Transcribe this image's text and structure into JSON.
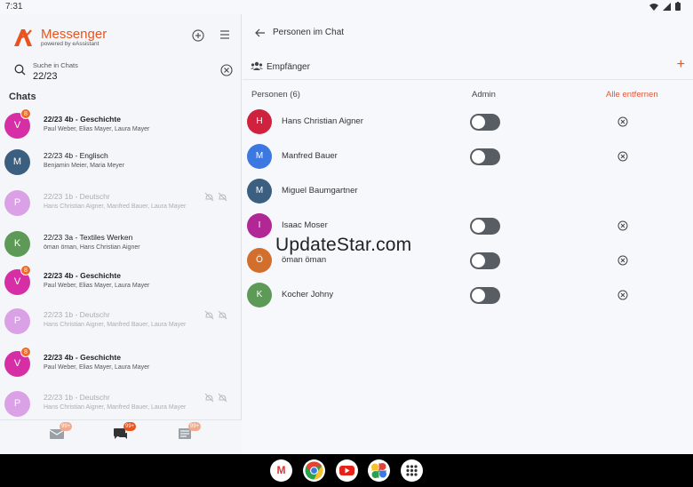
{
  "status_bar": {
    "time": "7:31",
    "icons": [
      "wifi-icon",
      "signal-icon",
      "battery-icon"
    ]
  },
  "brand": {
    "name": "Messenger",
    "tagline": "powered by eAssistant",
    "color": "#e8541f"
  },
  "search": {
    "label": "Suche in Chats",
    "value": "22/23"
  },
  "chats_heading": "Chats",
  "chats": [
    {
      "initial": "V",
      "color": "#d62fa5",
      "badge": "8",
      "title": "22/23  4b - Geschichte",
      "members": "Paul Weber, Elias Mayer, Laura Mayer",
      "bold": true,
      "muted": false
    },
    {
      "initial": "M",
      "color": "#3b5f80",
      "badge": "",
      "title": "22/23  4b - Englisch",
      "members": "Benjamin Meier, Maria Meyer",
      "bold": false,
      "muted": false
    },
    {
      "initial": "P",
      "color": "#d07ee0",
      "badge": "",
      "title": "22/23  1b - Deutschr",
      "members": "Hans Christian Aigner, Manfred Bauer, Laura Mayer",
      "bold": false,
      "muted": true
    },
    {
      "initial": "K",
      "color": "#5e9a57",
      "badge": "",
      "title": "22/23 3a - Textiles Werken",
      "members": "öman öman, Hans Christian Aigner",
      "bold": false,
      "muted": false
    },
    {
      "initial": "V",
      "color": "#d62fa5",
      "badge": "8",
      "title": "22/23  4b - Geschichte",
      "members": "Paul Weber, Elias Mayer, Laura Mayer",
      "bold": true,
      "muted": false
    },
    {
      "initial": "P",
      "color": "#d07ee0",
      "badge": "",
      "title": "22/23  1b - Deutschr",
      "members": "Hans Christian Aigner, Manfred Bauer, Laura Mayer",
      "bold": false,
      "muted": true
    },
    {
      "initial": "V",
      "color": "#d62fa5",
      "badge": "8",
      "title": "22/23  4b - Geschichte",
      "members": "Paul Weber, Elias Mayer, Laura Mayer",
      "bold": true,
      "muted": false
    },
    {
      "initial": "P",
      "color": "#d07ee0",
      "badge": "",
      "title": "22/23  1b - Deutschr",
      "members": "Hans Christian Aigner, Manfred Bauer, Laura Mayer",
      "bold": false,
      "muted": true
    }
  ],
  "bottom_nav": [
    {
      "icon": "mail-icon",
      "badge": "99+",
      "active": false
    },
    {
      "icon": "chat-icon",
      "badge": "99+",
      "active": true
    },
    {
      "icon": "news-icon",
      "badge": "99+",
      "active": false
    }
  ],
  "detail": {
    "title": "Personen im Chat",
    "recipients_label": "Empfänger",
    "persons_header": "Personen (6)",
    "admin_header": "Admin",
    "remove_all": "Alle entfernen",
    "persons": [
      {
        "initial": "H",
        "name": "Hans Christian Aigner",
        "color": "#d0223e",
        "toggle": true,
        "removable": true
      },
      {
        "initial": "M",
        "name": "Manfred Bauer",
        "color": "#3b78e2",
        "toggle": true,
        "removable": true
      },
      {
        "initial": "M",
        "name": "Miguel Baumgartner",
        "color": "#3b5f80",
        "toggle": false,
        "removable": false
      },
      {
        "initial": "I",
        "name": "Isaac Moser",
        "color": "#b12795",
        "toggle": true,
        "removable": true
      },
      {
        "initial": "Ö",
        "name": "öman öman",
        "color": "#d36f2c",
        "toggle": true,
        "removable": true
      },
      {
        "initial": "K",
        "name": "Kocher Johny",
        "color": "#5e9a57",
        "toggle": true,
        "removable": true
      }
    ]
  },
  "watermark": "UpdateStar.com",
  "dock_apps": [
    "gmail-icon",
    "chrome-icon",
    "youtube-icon",
    "photos-icon",
    "app-drawer-icon"
  ]
}
